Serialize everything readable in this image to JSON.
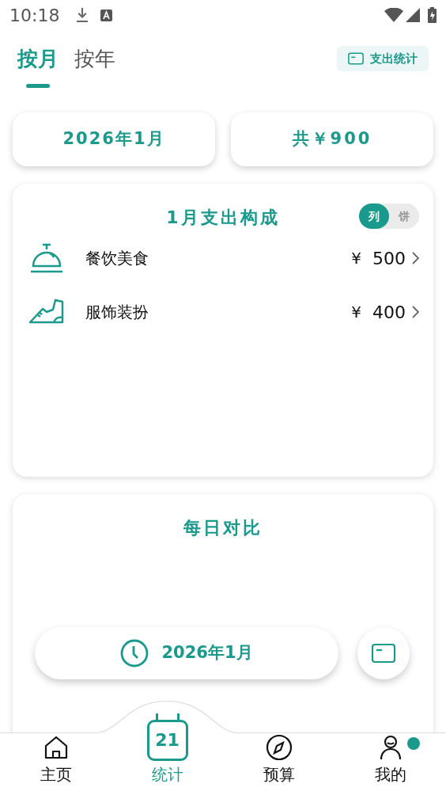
{
  "status_bar": {
    "time": "10:18"
  },
  "tabs": [
    {
      "label": "按月",
      "selected": true
    },
    {
      "label": "按年",
      "selected": false
    }
  ],
  "stats_button": "支出统计",
  "summary": {
    "period": "2026年1月",
    "total": "共￥900"
  },
  "composition": {
    "title": "1月支出构成",
    "view_toggle": [
      {
        "label": "列",
        "selected": true
      },
      {
        "label": "饼",
        "selected": false
      }
    ],
    "items": [
      {
        "kind": "dining",
        "name": "餐饮美食",
        "currency": "¥",
        "amount": "500"
      },
      {
        "kind": "clothing",
        "name": "服饰装扮",
        "currency": "¥",
        "amount": "400"
      }
    ]
  },
  "daily": {
    "title": "每日对比"
  },
  "date_pill": "2026年1月",
  "bottom_nav": [
    {
      "kind": "home",
      "label": "主页",
      "selected": false,
      "badge": false
    },
    {
      "kind": "calendar",
      "label": "统计",
      "icon_text": "21",
      "selected": true,
      "badge": false
    },
    {
      "kind": "compass",
      "label": "预算",
      "selected": false,
      "badge": false
    },
    {
      "kind": "person",
      "label": "我的",
      "selected": false,
      "badge": true
    }
  ]
}
